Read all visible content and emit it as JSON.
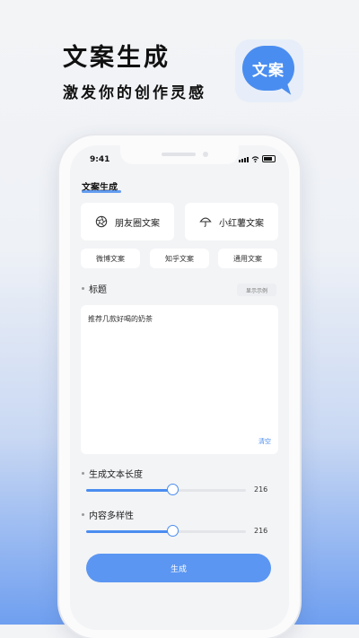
{
  "hero": {
    "title": "文案生成",
    "subtitle": "激发你的创作灵感",
    "app_icon_text": "文案"
  },
  "status_bar": {
    "time": "9:41",
    "icons": [
      "signal-icon",
      "wifi-icon",
      "battery-icon"
    ]
  },
  "page": {
    "title": "文案生成"
  },
  "types_primary": [
    {
      "label": "朋友圈文案",
      "icon": "aperture-icon"
    },
    {
      "label": "小红薯文案",
      "icon": "umbrella-icon"
    }
  ],
  "types_secondary": [
    {
      "label": "微博文案"
    },
    {
      "label": "知乎文案"
    },
    {
      "label": "通用文案"
    }
  ],
  "topic": {
    "label": "标题",
    "example_button": "显示示例",
    "value": "推荐几款好喝的奶茶",
    "clear_label": "清空"
  },
  "length": {
    "label": "生成文本长度",
    "value": "216",
    "fraction": 0.54
  },
  "diversity": {
    "label": "内容多样性",
    "value": "216",
    "fraction": 0.54
  },
  "generate_button": "生成",
  "colors": {
    "accent": "#4a8df0",
    "button": "#5b96f2",
    "background": "#f3f4f6"
  }
}
